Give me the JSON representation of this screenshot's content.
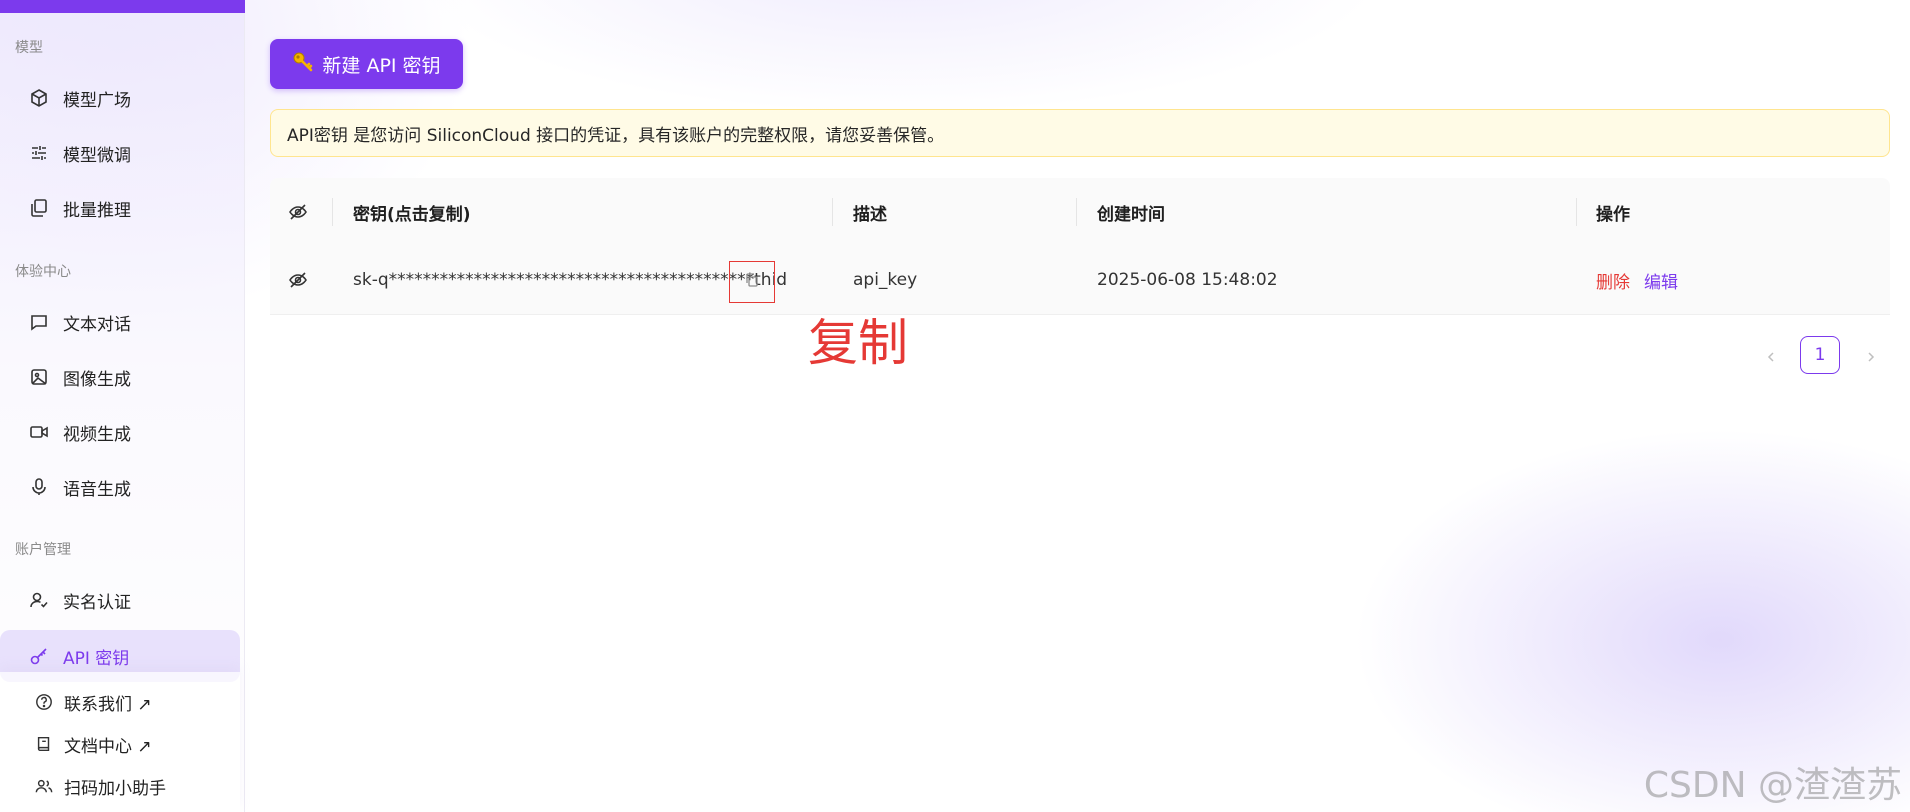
{
  "sidebar": {
    "sections": {
      "models": "模型",
      "experience": "体验中心",
      "account": "账户管理"
    },
    "items": [
      {
        "label": "模型广场",
        "icon": "cube-icon"
      },
      {
        "label": "模型微调",
        "icon": "sliders-icon"
      },
      {
        "label": "批量推理",
        "icon": "copy-stack-icon"
      },
      {
        "label": "文本对话",
        "icon": "chat-icon"
      },
      {
        "label": "图像生成",
        "icon": "image-icon"
      },
      {
        "label": "视频生成",
        "icon": "video-icon"
      },
      {
        "label": "语音生成",
        "icon": "mic-icon"
      },
      {
        "label": "实名认证",
        "icon": "user-check-icon"
      },
      {
        "label": "API 密钥",
        "icon": "key-icon",
        "active": true
      }
    ],
    "footer": [
      {
        "label": "联系我们 ↗",
        "icon": "help-icon"
      },
      {
        "label": "文档中心 ↗",
        "icon": "book-icon"
      },
      {
        "label": "扫码加小助手",
        "icon": "users-icon"
      }
    ]
  },
  "main": {
    "new_key_button": "新建 API 密钥",
    "notice": "API密钥 是您访问 SiliconCloud 接口的凭证，具有该账户的完整权限，请您妥善保管。",
    "table": {
      "headers": {
        "key": "密钥(点击复制)",
        "description": "描述",
        "created": "创建时间",
        "actions": "操作"
      },
      "rows": [
        {
          "key": "sk-q*******************************************thid",
          "description": "api_key",
          "created": "2025-06-08 15:48:02",
          "delete": "删除",
          "edit": "编辑"
        }
      ]
    },
    "pagination": {
      "current": "1"
    },
    "annotation": "复制"
  },
  "watermark": "CSDN @渣渣苏",
  "colors": {
    "accent": "#7c3aed",
    "danger": "#e53935",
    "notice_bg": "#fffbe6"
  }
}
